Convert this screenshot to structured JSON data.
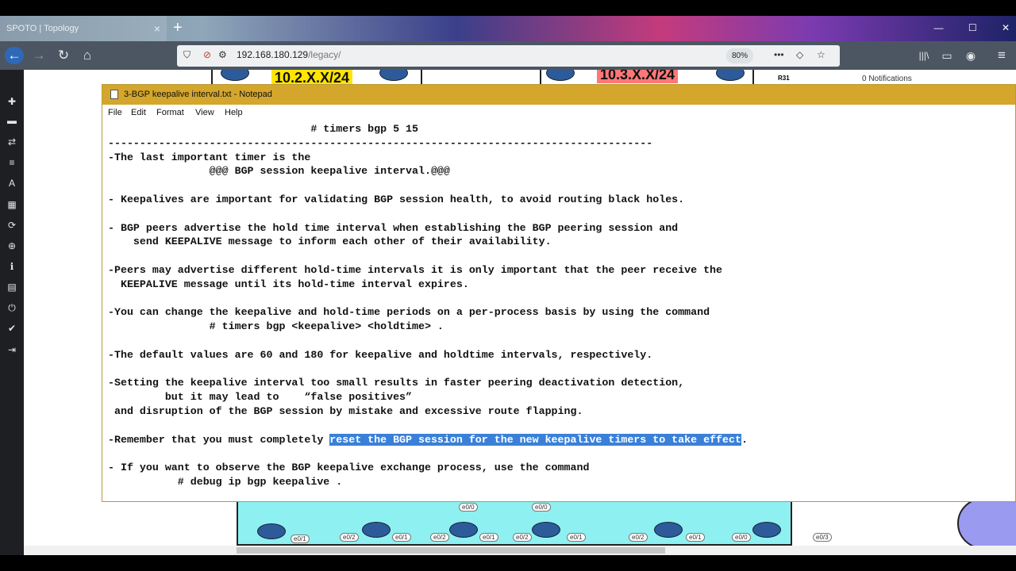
{
  "browser": {
    "tab_title": "SPOTO | Topology",
    "tab_close": "×",
    "new_tab": "+",
    "url_host": "192.168.180.129",
    "url_path": "/legacy/",
    "zoom": "80%",
    "nav": {
      "back": "←",
      "forward": "→",
      "reload": "↻",
      "home": "⌂"
    },
    "toolbar": {
      "more": "•••",
      "pocket": "◇",
      "star": "☆",
      "library": "|||\\",
      "sidebar": "▭",
      "account": "◉",
      "menu": "≡"
    },
    "window": {
      "minimize": "—",
      "maximize": "☐",
      "close": "✕"
    }
  },
  "sidebar": {
    "icons": [
      "plus-icon",
      "drive-icon",
      "swap-icon",
      "list-icon",
      "text-icon",
      "grid-icon",
      "refresh-icon",
      "zoom-icon",
      "info-icon",
      "table-icon",
      "power-icon",
      "check-icon",
      "logout-icon"
    ],
    "glyphs": [
      "✚",
      "▬",
      "⇄",
      "≡",
      "A",
      "▦",
      "⟳",
      "⊕",
      "ℹ",
      "▤",
      "⏻",
      "✔",
      "⇥"
    ]
  },
  "topology": {
    "subnet_1": "10.2.X.X/24",
    "subnet_2": "10.3.X.X/24",
    "router_label": "R31",
    "notifications": "0 Notifications",
    "ports": [
      "e0/1",
      "e0/2",
      "e0/1",
      "e0/2",
      "e0/1",
      "e0/2",
      "e0/1",
      "e0/2",
      "e0/1",
      "e0/0",
      "e0/3",
      "e0/0",
      "e0/0",
      "e0/1",
      "e0/0"
    ]
  },
  "notepad": {
    "title": "3-BGP keepalive interval.txt - Notepad",
    "menu": [
      "File",
      "Edit",
      "Format",
      "View",
      "Help"
    ],
    "lines": [
      "                                # timers bgp 5 15",
      "--------------------------------------------------------------------------------------",
      "-The last important timer is the",
      "                @@@ BGP session keepalive interval.@@@",
      "",
      "- Keepalives are important for validating BGP session health, to avoid routing black holes.",
      "",
      "- BGP peers advertise the hold time interval when establishing the BGP peering session and",
      "    send KEEPALIVE message to inform each other of their availability.",
      "",
      "-Peers may advertise different hold-time intervals it is only important that the peer receive the",
      "  KEEPALIVE message until its hold-time interval expires.",
      "",
      "-You can change the keepalive and hold-time periods on a per-process basis by using the command",
      "                # timers bgp <keepalive> <holdtime> .",
      "",
      "-The default values are 60 and 180 for keepalive and holdtime intervals, respectively.",
      "",
      "-Setting the keepalive interval too small results in faster peering deactivation detection,",
      "         but it may lead to    “false positives”",
      " and disruption of the BGP session by mistake and excessive route flapping.",
      "",
      "__REMEMBER__",
      "",
      "- If you want to observe the BGP keepalive exchange process, use the command",
      "           # debug ip bgp keepalive ."
    ],
    "remember_before": "-Remember that you must completely ",
    "remember_selected": "reset the BGP session for the new keepalive timers to take effect",
    "remember_after": "."
  }
}
